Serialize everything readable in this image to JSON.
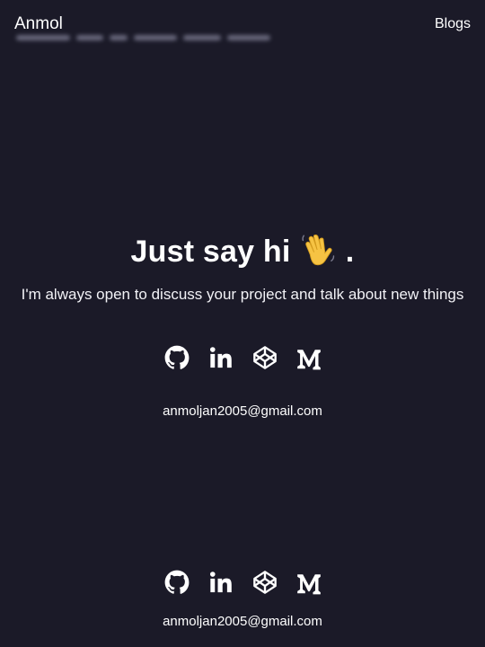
{
  "header": {
    "brand": "Anmol",
    "nav": {
      "blogs_label": "Blogs"
    }
  },
  "hero": {
    "title": "Just say hi",
    "title_suffix": ".",
    "description": "I'm always open to discuss your project and talk about new things"
  },
  "contact": {
    "email": "anmoljan2005@gmail.com",
    "socials": [
      "github-icon",
      "linkedin-icon",
      "codepen-icon",
      "medium-icon"
    ]
  },
  "footer": {
    "email": "anmoljan2005@gmail.com",
    "socials": [
      "github-icon",
      "linkedin-icon",
      "codepen-icon",
      "medium-icon"
    ]
  },
  "colors": {
    "background": "#1b1a28",
    "text": "#ffffff",
    "emoji": "#f6c343"
  }
}
